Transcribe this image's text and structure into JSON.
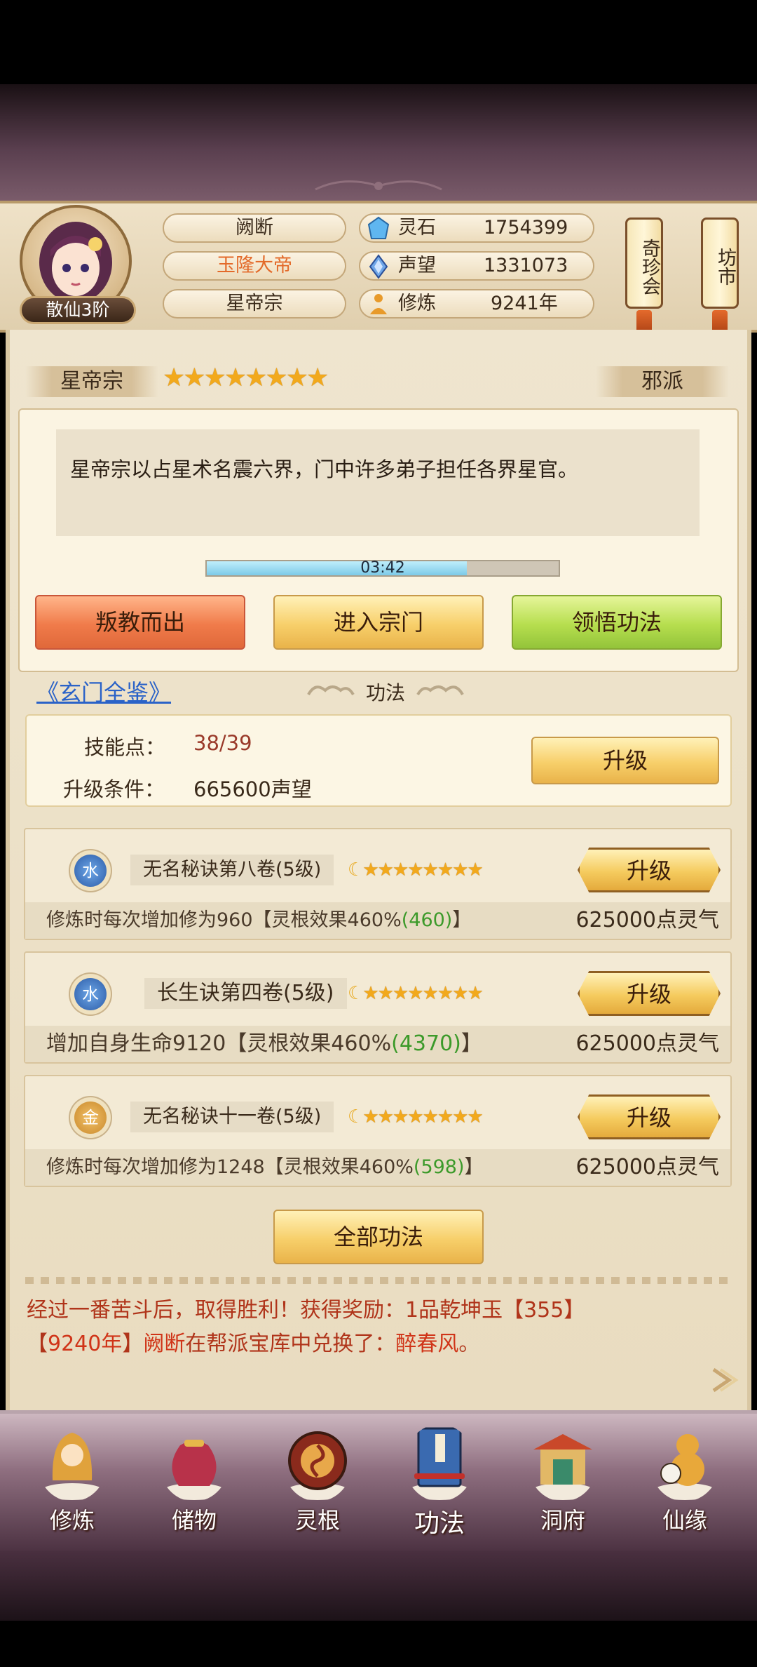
{
  "header": {
    "rank": "散仙3阶",
    "name": "阙断",
    "title": "玉隆大帝",
    "sect": "星帝宗",
    "stats": [
      {
        "icon": "spirit-stone-icon",
        "label": "灵石",
        "value": "1754399"
      },
      {
        "icon": "prestige-icon",
        "label": "声望",
        "value": "1331073"
      },
      {
        "icon": "cultivation-icon",
        "label": "修炼",
        "value": "9241年"
      }
    ],
    "shops": [
      "奇珍会",
      "坊市"
    ]
  },
  "sect_panel": {
    "name": "星帝宗",
    "stars": 8,
    "alignment": "邪派",
    "description": "星帝宗以占星术名震六界，门中许多弟子担任各界星官。",
    "timer": "03:42",
    "timer_progress": 0.74,
    "buttons": {
      "leave": "叛教而出",
      "enter": "进入宗门",
      "comprehend": "领悟功法"
    }
  },
  "techniques": {
    "link": "《玄门全鉴》",
    "section_title": "功法",
    "skill_points_label": "技能点：",
    "skill_points_value": "38/39",
    "upgrade_cond_label": "升级条件：",
    "upgrade_cond_value": "665600声望",
    "upgrade_label": "升级",
    "items": [
      {
        "element": "水",
        "name": "无名秘诀第八卷(5级)",
        "stars": 8,
        "desc_prefix": "修炼时每次增加修为960【灵根效果460%",
        "desc_value": "(460)",
        "desc_suffix": "】",
        "cost": "625000点灵气",
        "button": "升级"
      },
      {
        "element": "水",
        "name": "长生诀第四卷(5级)",
        "stars": 8,
        "desc_prefix": "增加自身生命9120【灵根效果460%",
        "desc_value": "(4370)",
        "desc_suffix": "】",
        "cost": "625000点灵气",
        "button": "升级"
      },
      {
        "element": "金",
        "name": "无名秘诀十一卷(5级)",
        "stars": 8,
        "desc_prefix": "修炼时每次增加修为1248【灵根效果460%",
        "desc_value": "(598)",
        "desc_suffix": "】",
        "cost": "625000点灵气",
        "button": "升级"
      }
    ],
    "all_button": "全部功法"
  },
  "messages": {
    "line1": "经过一番苦斗后，取得胜利！获得奖励：1品乾坤玉【355】",
    "line2_bracket_open": "【",
    "line2_year": "9240年",
    "line2_bracket_close": "】",
    "line2_name": "阙断",
    "line2_mid": "在帮派宝库中兑换了：",
    "line2_item": "醉春风",
    "line2_end": "。"
  },
  "nav": [
    {
      "label": "修炼",
      "icon": "monk-icon"
    },
    {
      "label": "储物",
      "icon": "bag-icon"
    },
    {
      "label": "灵根",
      "icon": "spirit-root-icon"
    },
    {
      "label": "功法",
      "icon": "book-icon"
    },
    {
      "label": "洞府",
      "icon": "cave-house-icon"
    },
    {
      "label": "仙缘",
      "icon": "gourd-icon"
    }
  ],
  "colors": {
    "accent_orange": "#e36a2a",
    "green": "#3c9a2a",
    "red": "#c23a1a",
    "progress": "#8fd8f0"
  }
}
